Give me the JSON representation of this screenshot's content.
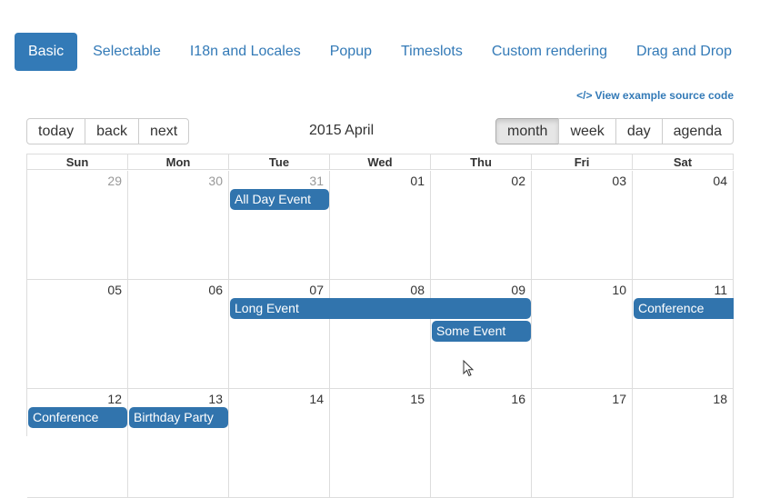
{
  "nav": {
    "items": [
      "Basic",
      "Selectable",
      "I18n and Locales",
      "Popup",
      "Timeslots",
      "Custom rendering",
      "Drag and Drop"
    ],
    "active": "Basic"
  },
  "source_link": {
    "icon": "code-icon",
    "icon_glyph": "</>",
    "label": "View example source code"
  },
  "toolbar": {
    "today": "today",
    "back": "back",
    "next": "next",
    "label": "2015 April",
    "views": [
      "month",
      "week",
      "day",
      "agenda"
    ],
    "active_view": "month"
  },
  "calendar": {
    "weekdays": [
      "Sun",
      "Mon",
      "Tue",
      "Wed",
      "Thu",
      "Fri",
      "Sat"
    ],
    "weeks": [
      [
        {
          "d": "29",
          "off": true
        },
        {
          "d": "30",
          "off": true
        },
        {
          "d": "31",
          "off": true
        },
        {
          "d": "01"
        },
        {
          "d": "02"
        },
        {
          "d": "03"
        },
        {
          "d": "04"
        }
      ],
      [
        {
          "d": "05"
        },
        {
          "d": "06"
        },
        {
          "d": "07"
        },
        {
          "d": "08"
        },
        {
          "d": "09"
        },
        {
          "d": "10"
        },
        {
          "d": "11"
        }
      ],
      [
        {
          "d": "12"
        },
        {
          "d": "13"
        },
        {
          "d": "14"
        },
        {
          "d": "15"
        },
        {
          "d": "16"
        },
        {
          "d": "17"
        },
        {
          "d": "18"
        }
      ]
    ],
    "events": [
      {
        "title": "All Day Event",
        "week": 0,
        "start": 2,
        "span": 1,
        "slot": 0
      },
      {
        "title": "Long Event",
        "week": 1,
        "start": 2,
        "span": 3,
        "slot": 0
      },
      {
        "title": "Some Event",
        "week": 1,
        "start": 4,
        "span": 1,
        "slot": 1
      },
      {
        "title": "Conference",
        "week": 1,
        "start": 6,
        "span": 1,
        "slot": 0,
        "continues": true
      },
      {
        "title": "Conference",
        "week": 2,
        "start": 0,
        "span": 1,
        "slot": 0
      },
      {
        "title": "Birthday Party",
        "week": 2,
        "start": 1,
        "span": 1,
        "slot": 0
      }
    ]
  },
  "colors": {
    "accent": "#337ab7",
    "event": "#3174ad"
  }
}
